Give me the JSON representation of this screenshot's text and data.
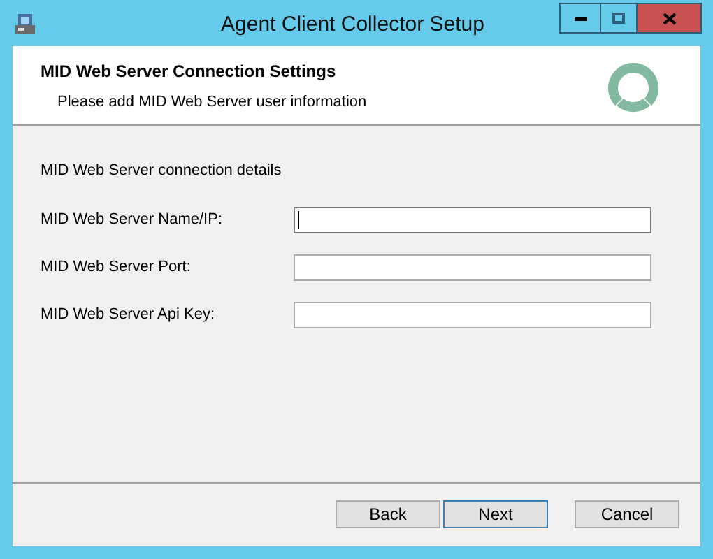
{
  "window": {
    "title": "Agent Client Collector Setup"
  },
  "header": {
    "title": "MID Web Server Connection Settings",
    "subtitle": "Please add MID Web Server user information"
  },
  "section_label": "MID Web Server connection details",
  "fields": [
    {
      "label": "MID Web Server Name/IP:",
      "focused": true
    },
    {
      "label": "MID Web Server Port:",
      "focused": false
    },
    {
      "label": "MID Web Server Api Key:",
      "focused": false
    }
  ],
  "buttons": [
    {
      "label": "Back",
      "default": false
    },
    {
      "label": "Next",
      "default": true
    },
    {
      "label": "Cancel",
      "default": false
    }
  ]
}
